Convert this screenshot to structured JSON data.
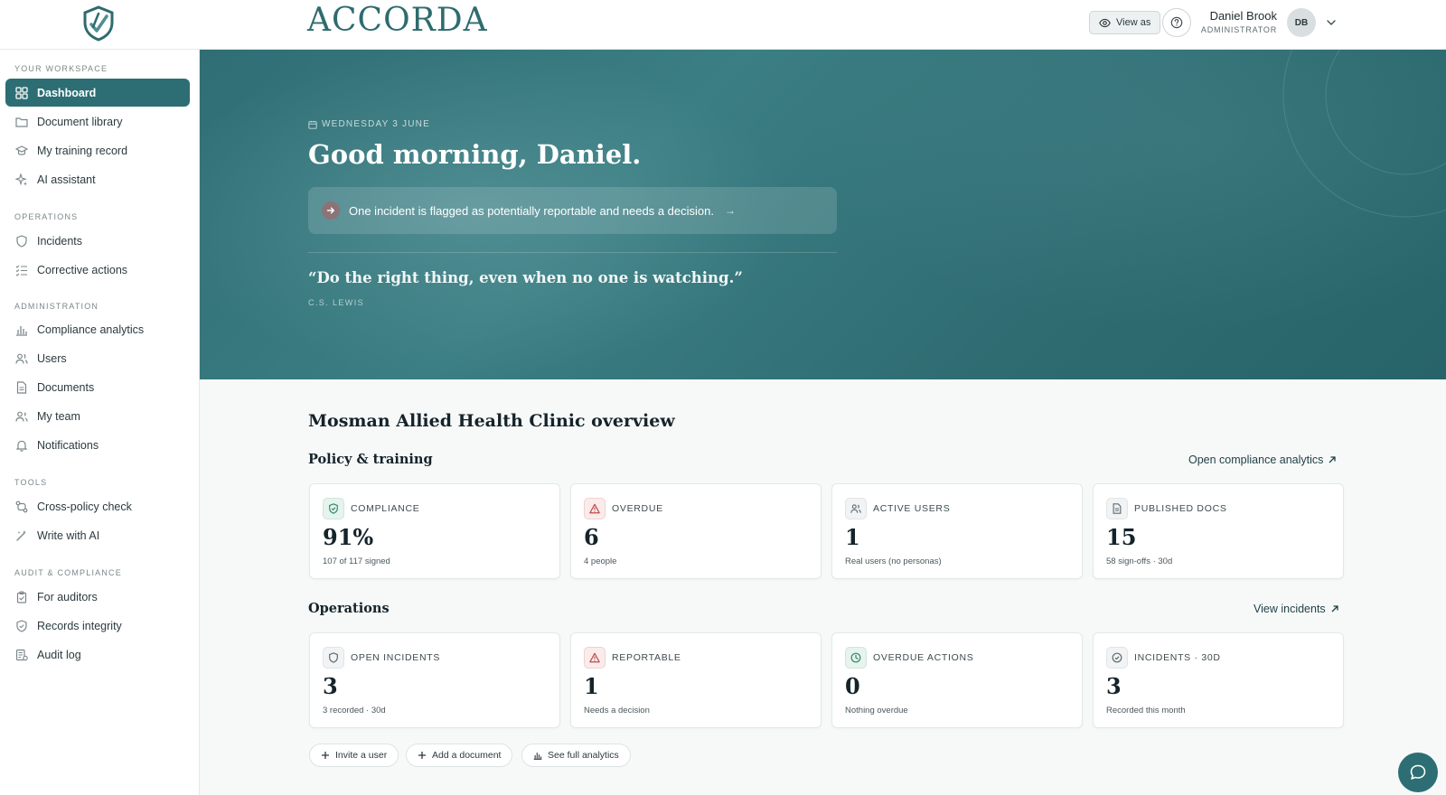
{
  "header": {
    "brand": "ACCORDA",
    "view_as_label": "View as",
    "user_name": "Daniel Brook",
    "user_role": "ADMINISTRATOR",
    "avatar_initials": "DB"
  },
  "sidebar": {
    "sections": [
      {
        "title": "YOUR WORKSPACE",
        "items": [
          {
            "label": "Dashboard",
            "icon": "grid-icon",
            "active": true
          },
          {
            "label": "Document library",
            "icon": "folder-icon"
          },
          {
            "label": "My training record",
            "icon": "graduation-cap-icon"
          },
          {
            "label": "AI assistant",
            "icon": "sparkle-icon"
          }
        ]
      },
      {
        "title": "OPERATIONS",
        "items": [
          {
            "label": "Incidents",
            "icon": "shield-icon"
          },
          {
            "label": "Corrective actions",
            "icon": "checklist-icon"
          }
        ]
      },
      {
        "title": "ADMINISTRATION",
        "items": [
          {
            "label": "Compliance analytics",
            "icon": "bar-chart-icon"
          },
          {
            "label": "Users",
            "icon": "users-icon"
          },
          {
            "label": "Documents",
            "icon": "document-icon"
          },
          {
            "label": "My team",
            "icon": "team-icon"
          },
          {
            "label": "Notifications",
            "icon": "bell-icon"
          }
        ]
      },
      {
        "title": "TOOLS",
        "items": [
          {
            "label": "Cross-policy check",
            "icon": "git-compare-icon"
          },
          {
            "label": "Write with AI",
            "icon": "magic-wand-icon"
          }
        ]
      },
      {
        "title": "AUDIT & COMPLIANCE",
        "items": [
          {
            "label": "For auditors",
            "icon": "clipboard-icon"
          },
          {
            "label": "Records integrity",
            "icon": "shield-check-icon"
          },
          {
            "label": "Audit log",
            "icon": "log-icon"
          }
        ]
      }
    ]
  },
  "hero": {
    "date": "WEDNESDAY 3 JUNE",
    "greeting": "Good morning, Daniel.",
    "alert": "One incident is flagged as potentially reportable and needs a decision.",
    "alert_arrow": "→",
    "quote": "“Do the right thing, even when no one is watching.”",
    "quote_author": "C.S. LEWIS"
  },
  "overview": {
    "title": "Mosman Allied Health Clinic overview",
    "policy": {
      "title": "Policy & training",
      "link": "Open compliance analytics",
      "cards": [
        {
          "label": "COMPLIANCE",
          "value": "91%",
          "sub": "107 of 117 signed",
          "icon": "shield-check-icon",
          "tone": "green"
        },
        {
          "label": "OVERDUE",
          "value": "6",
          "sub": "4 people",
          "icon": "warning-triangle-icon",
          "tone": "red"
        },
        {
          "label": "ACTIVE USERS",
          "value": "1",
          "sub": "Real users (no personas)",
          "icon": "users-icon",
          "tone": "grey"
        },
        {
          "label": "PUBLISHED DOCS",
          "value": "15",
          "sub": "58 sign-offs · 30d",
          "icon": "document-icon",
          "tone": "grey"
        }
      ]
    },
    "operations": {
      "title": "Operations",
      "link": "View incidents",
      "cards": [
        {
          "label": "OPEN INCIDENTS",
          "value": "3",
          "sub": "3 recorded · 30d",
          "icon": "shield-icon",
          "tone": "grey"
        },
        {
          "label": "REPORTABLE",
          "value": "1",
          "sub": "Needs a decision",
          "icon": "warning-triangle-icon",
          "tone": "red"
        },
        {
          "label": "OVERDUE ACTIONS",
          "value": "0",
          "sub": "Nothing overdue",
          "icon": "clock-icon",
          "tone": "green"
        },
        {
          "label": "INCIDENTS · 30D",
          "value": "3",
          "sub": "Recorded this month",
          "icon": "check-circle-icon",
          "tone": "grey"
        }
      ]
    },
    "quick_actions": [
      {
        "label": "Invite a user",
        "icon": "plus-icon"
      },
      {
        "label": "Add a document",
        "icon": "plus-icon"
      },
      {
        "label": "See full analytics",
        "icon": "bar-chart-icon"
      }
    ]
  },
  "colors": {
    "accent": "#2c6e73",
    "danger": "#c0494b",
    "success": "#2f8a66"
  }
}
